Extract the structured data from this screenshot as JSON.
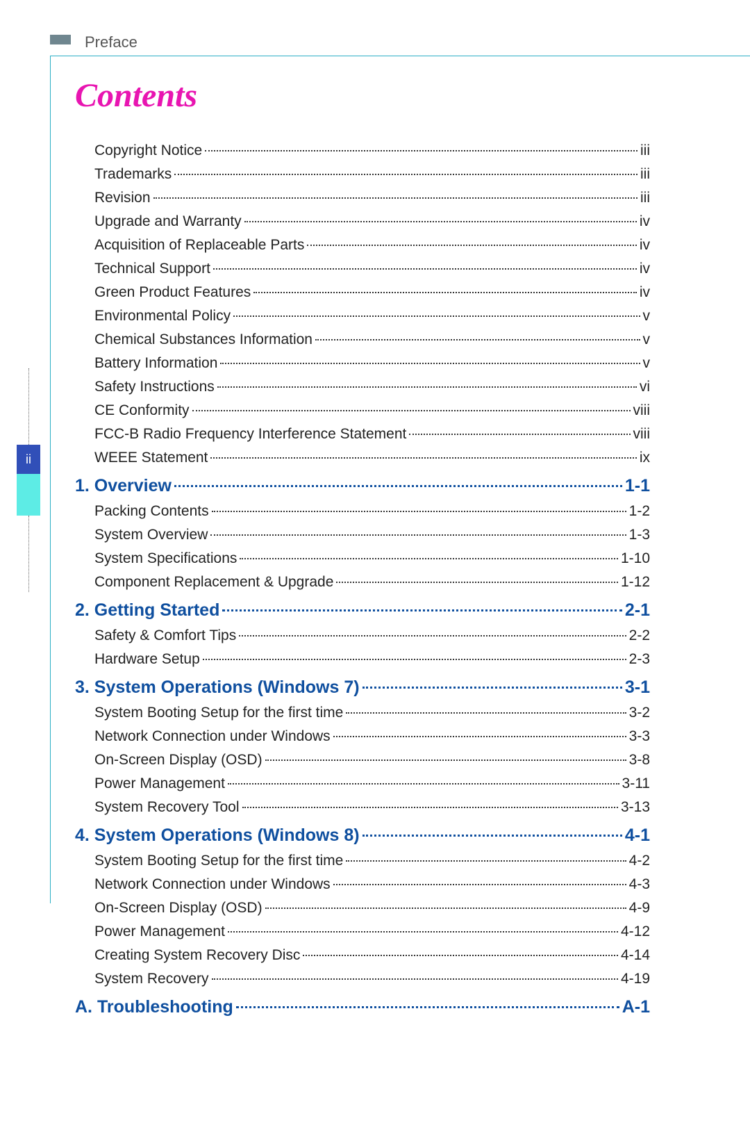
{
  "header": {
    "label": "Preface"
  },
  "page_number": "ii",
  "title": "Contents",
  "toc": [
    {
      "type": "item",
      "label": "Copyright Notice",
      "page": "iii"
    },
    {
      "type": "item",
      "label": "Trademarks",
      "page": "iii"
    },
    {
      "type": "item",
      "label": "Revision",
      "page": "iii"
    },
    {
      "type": "item",
      "label": "Upgrade and Warranty",
      "page": "iv"
    },
    {
      "type": "item",
      "label": "Acquisition of Replaceable Parts",
      "page": "iv"
    },
    {
      "type": "item",
      "label": "Technical Support",
      "page": "iv"
    },
    {
      "type": "item",
      "label": "Green Product Features",
      "page": "iv"
    },
    {
      "type": "item",
      "label": "Environmental Policy",
      "page": "v"
    },
    {
      "type": "item",
      "label": "Chemical Substances Information",
      "page": "v"
    },
    {
      "type": "item",
      "label": "Battery Information",
      "page": "v"
    },
    {
      "type": "item",
      "label": "Safety Instructions",
      "page": "vi"
    },
    {
      "type": "item",
      "label": "CE Conformity",
      "page": "viii"
    },
    {
      "type": "item",
      "label": "FCC-B Radio Frequency Interference Statement",
      "page": "viii"
    },
    {
      "type": "item",
      "label": "WEEE Statement",
      "page": "ix"
    },
    {
      "type": "section",
      "label": "1. Overview",
      "page": "1-1"
    },
    {
      "type": "item",
      "label": "Packing Contents",
      "page": "1-2"
    },
    {
      "type": "item",
      "label": "System Overview",
      "page": "1-3"
    },
    {
      "type": "item",
      "label": "System Specifications",
      "page": "1-10"
    },
    {
      "type": "item",
      "label": "Component Replacement & Upgrade",
      "page": "1-12"
    },
    {
      "type": "section",
      "label": "2. Getting Started",
      "page": "2-1"
    },
    {
      "type": "item",
      "label": "Safety & Comfort Tips",
      "page": "2-2"
    },
    {
      "type": "item",
      "label": "Hardware Setup",
      "page": "2-3"
    },
    {
      "type": "section",
      "label": "3. System Operations (Windows 7)",
      "page": "3-1"
    },
    {
      "type": "item",
      "label": "System Booting Setup for the first time",
      "page": "3-2"
    },
    {
      "type": "item",
      "label": "Network Connection under Windows",
      "page": "3-3"
    },
    {
      "type": "item",
      "label": "On-Screen Display (OSD)",
      "page": "3-8"
    },
    {
      "type": "item",
      "label": "Power Management",
      "page": "3-11"
    },
    {
      "type": "item",
      "label": "System Recovery Tool",
      "page": "3-13"
    },
    {
      "type": "section",
      "label": "4. System Operations (Windows 8)",
      "page": "4-1"
    },
    {
      "type": "item",
      "label": "System Booting Setup for the first time",
      "page": "4-2"
    },
    {
      "type": "item",
      "label": "Network Connection under Windows",
      "page": "4-3"
    },
    {
      "type": "item",
      "label": "On-Screen Display (OSD)",
      "page": "4-9"
    },
    {
      "type": "item",
      "label": "Power Management",
      "page": "4-12"
    },
    {
      "type": "item",
      "label": "Creating System Recovery Disc",
      "page": "4-14"
    },
    {
      "type": "item",
      "label": "System Recovery",
      "page": "4-19"
    },
    {
      "type": "section",
      "label": "A. Troubleshooting",
      "page": "A-1"
    }
  ]
}
